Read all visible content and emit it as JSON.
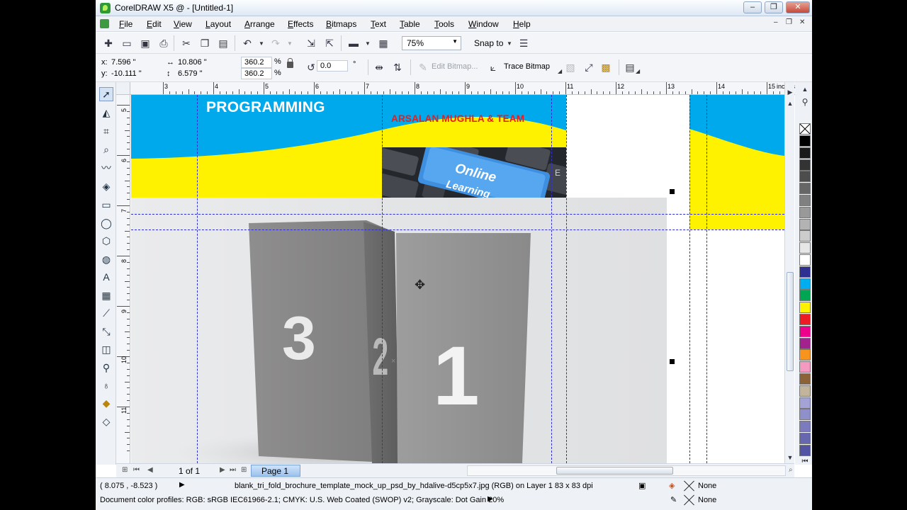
{
  "window": {
    "title": "CorelDRAW X5 @ - [Untitled-1]"
  },
  "menu": [
    "File",
    "Edit",
    "View",
    "Layout",
    "Arrange",
    "Effects",
    "Bitmaps",
    "Text",
    "Table",
    "Tools",
    "Window",
    "Help"
  ],
  "standard_toolbar": {
    "zoom_value": "75%",
    "snap_to_label": "Snap to"
  },
  "property_bar": {
    "x_label": "x:",
    "x_value": "7.596 \"",
    "y_label": "y:",
    "y_value": "-10.111 \"",
    "width_value": "10.806 \"",
    "height_value": "6.579 \"",
    "scale_x": "360.2",
    "scale_y": "360.2",
    "percent_sign": "%",
    "rotation": "0.0",
    "degree_sign": "°",
    "edit_bitmap_label": "Edit Bitmap...",
    "trace_bitmap_label": "Trace Bitmap"
  },
  "ruler": {
    "units": "inches",
    "top_ticks": [
      "3",
      "4",
      "5",
      "6",
      "7",
      "8",
      "9",
      "10",
      "11",
      "12",
      "13",
      "14",
      "15"
    ],
    "left_ticks": [
      "5",
      "6",
      "7",
      "8",
      "9",
      "10",
      "11"
    ]
  },
  "canvas": {
    "banner_title": "PROGRAMMING",
    "banner_team": "ARSALAN MUGHLA & TEAM",
    "key_text_line1": "Online",
    "key_text_line2": "Learning",
    "key_side_letter": "E",
    "brochure_numbers": [
      "3",
      "2",
      "1"
    ],
    "colors": {
      "banner_blue": "#00a8ec",
      "banner_yellow": "#fff200",
      "team_red": "#e61e1e",
      "key_blue": "#3e8fe0",
      "guide_blue": "#2f2fd0"
    }
  },
  "palette": [
    "#000000",
    "#1a1a1a",
    "#333333",
    "#4d4d4d",
    "#666666",
    "#808080",
    "#999999",
    "#b3b3b3",
    "#cccccc",
    "#e6e6e6",
    "#ffffff",
    "#2e3192",
    "#00aeef",
    "#00a651",
    "#fff200",
    "#ed1c24",
    "#ec008c",
    "#a3238e",
    "#f7941d",
    "#f49ac1",
    "#8c6239",
    "#c2b59b",
    "#a3a3d6",
    "#8f8fc9",
    "#7b7bbd",
    "#6767b0",
    "#5353a3"
  ],
  "page_nav": {
    "page_count": "1 of 1",
    "page_tab": "Page 1"
  },
  "status": {
    "cursor_coords": "( 8.075 , -8.523 )",
    "object_info": "blank_tri_fold_brochure_template_mock_up_psd_by_hdalive-d5cp5x7.jpg (RGB) on Layer 1 83 x 83 dpi",
    "fill_value": "None",
    "outline_value": "None",
    "color_profiles": "Document color profiles: RGB: sRGB IEC61966-2.1; CMYK: U.S. Web Coated (SWOP) v2; Grayscale: Dot Gain 20%"
  }
}
